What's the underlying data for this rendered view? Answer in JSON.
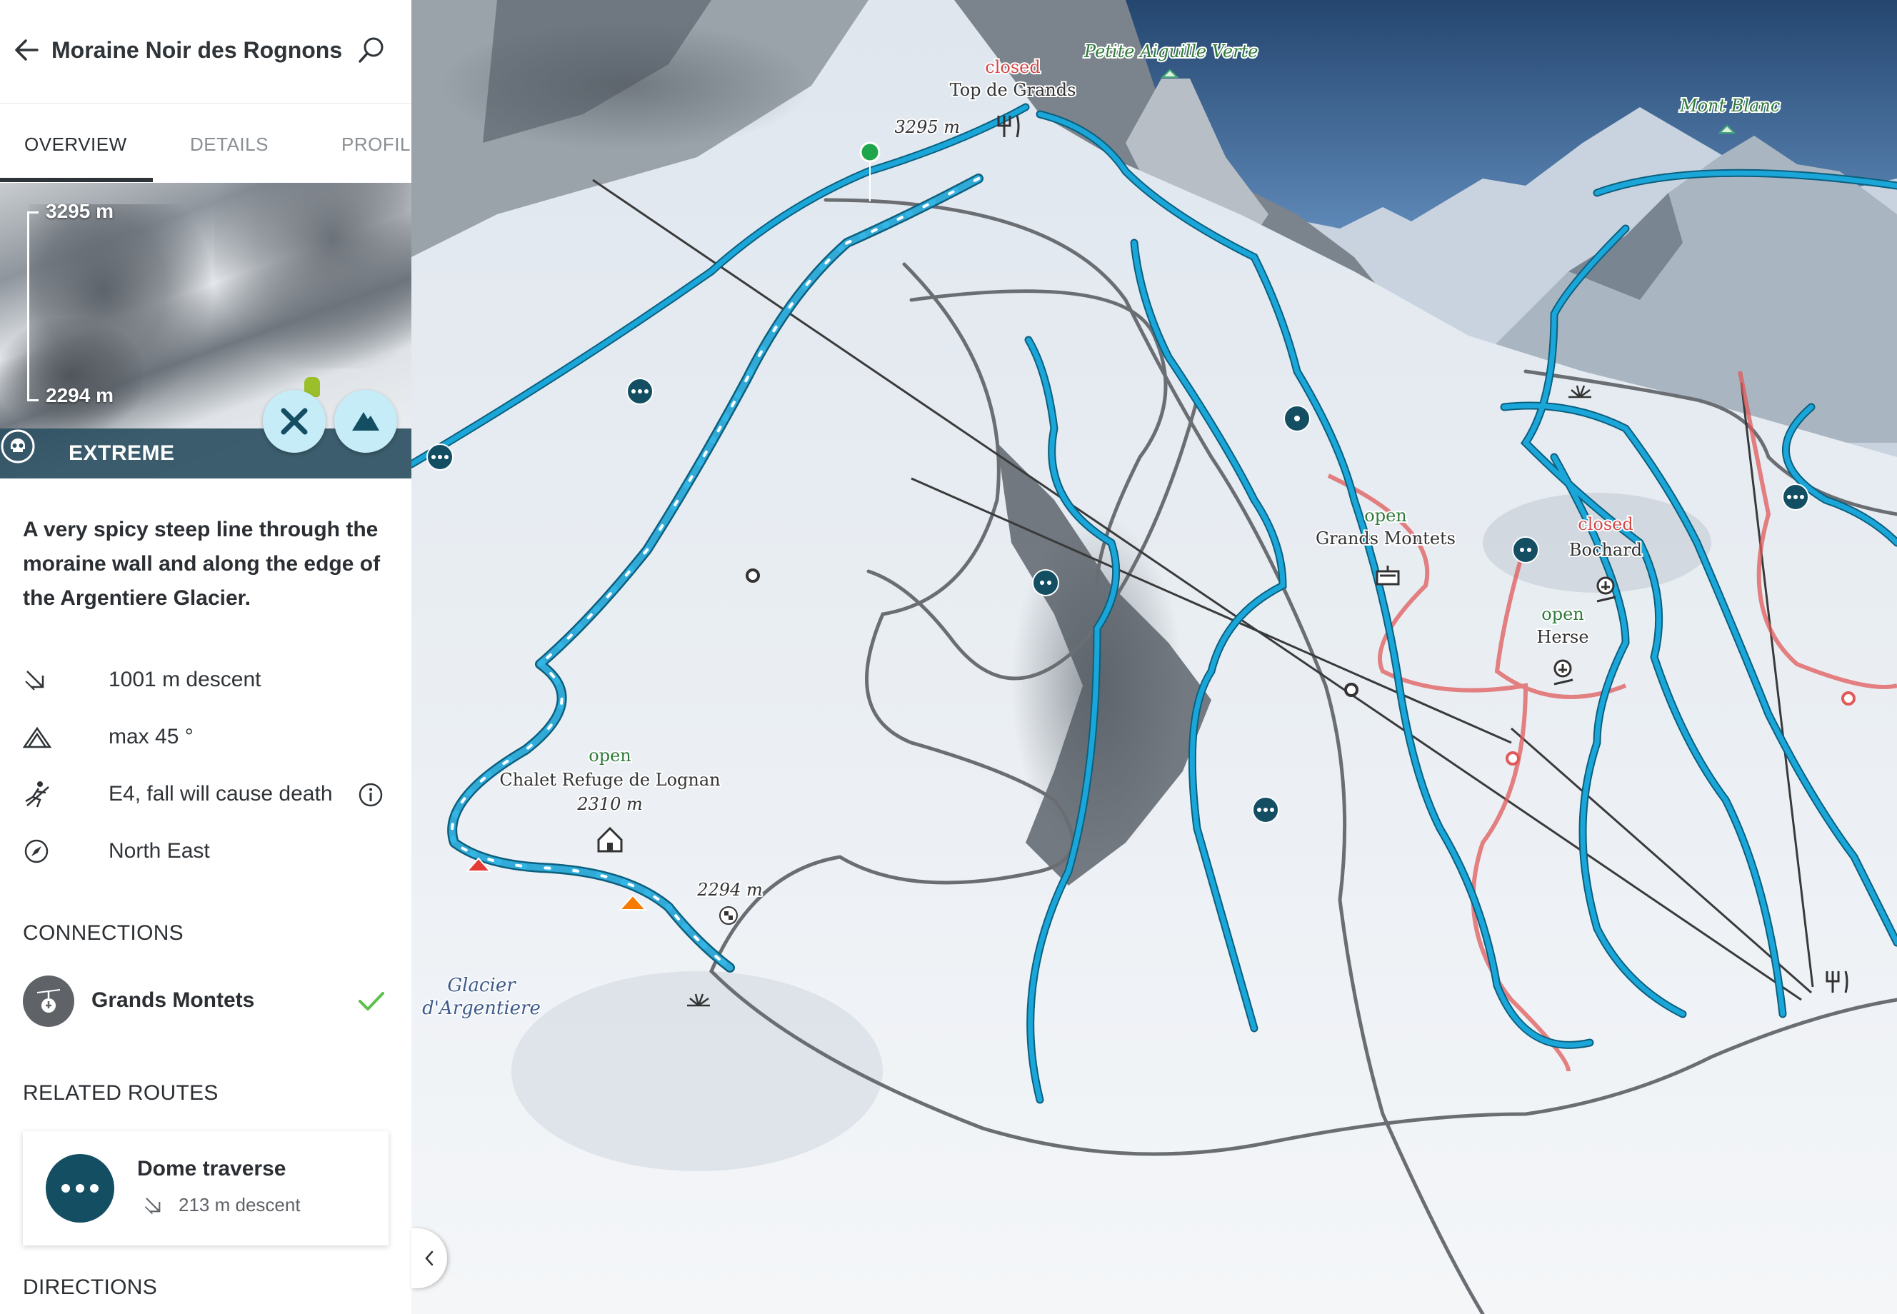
{
  "header": {
    "title": "Moraine Noir des Rognons"
  },
  "tabs": [
    {
      "label": "OVERVIEW"
    },
    {
      "label": "DETAILS"
    },
    {
      "label": "PROFILE"
    }
  ],
  "photo": {
    "top_elevation": "3295 m",
    "bottom_elevation": "2294 m",
    "difficulty": "EXTREME"
  },
  "description": "A very spicy steep line through the moraine wall and along the edge of the Argentiere Glacier.",
  "stats": [
    {
      "icon": "descent-icon",
      "text": "1001 m descent"
    },
    {
      "icon": "slope-icon",
      "text": "max 45 °"
    },
    {
      "icon": "fall-risk-icon",
      "text": "E4, fall will cause death"
    },
    {
      "icon": "compass-icon",
      "text": "North East"
    }
  ],
  "connections": {
    "title": "CONNECTIONS",
    "items": [
      {
        "name": "Grands Montets"
      }
    ]
  },
  "related": {
    "title": "RELATED ROUTES",
    "items": [
      {
        "name": "Dome traverse",
        "descent": "213 m descent"
      }
    ]
  },
  "directions": {
    "title": "DIRECTIONS"
  },
  "map": {
    "peaks": [
      {
        "name": "Petite Aiguille Verte"
      },
      {
        "name": "Mont Blanc"
      }
    ],
    "places": {
      "top_de_grands": {
        "status": "closed",
        "name": "Top de Grands",
        "elevation": "3295 m"
      },
      "grands_montets": {
        "status": "open",
        "name": "Grands Montets"
      },
      "bochard": {
        "status": "closed",
        "name": "Bochard"
      },
      "herse": {
        "status": "open",
        "name": "Herse"
      },
      "chalet": {
        "status": "open",
        "name": "Chalet Refuge de Lognan",
        "elevation": "2310 m"
      },
      "end_point": {
        "elevation": "2294 m"
      },
      "glacier": {
        "line1": "Glacier",
        "line2": "d'Argentiere"
      }
    },
    "colors": {
      "route": "#1aa6d9",
      "route_outline": "#0c5f7d",
      "closed_run": "#e05a5a",
      "lift": "#333333",
      "marker_dark": "#134e63"
    }
  }
}
